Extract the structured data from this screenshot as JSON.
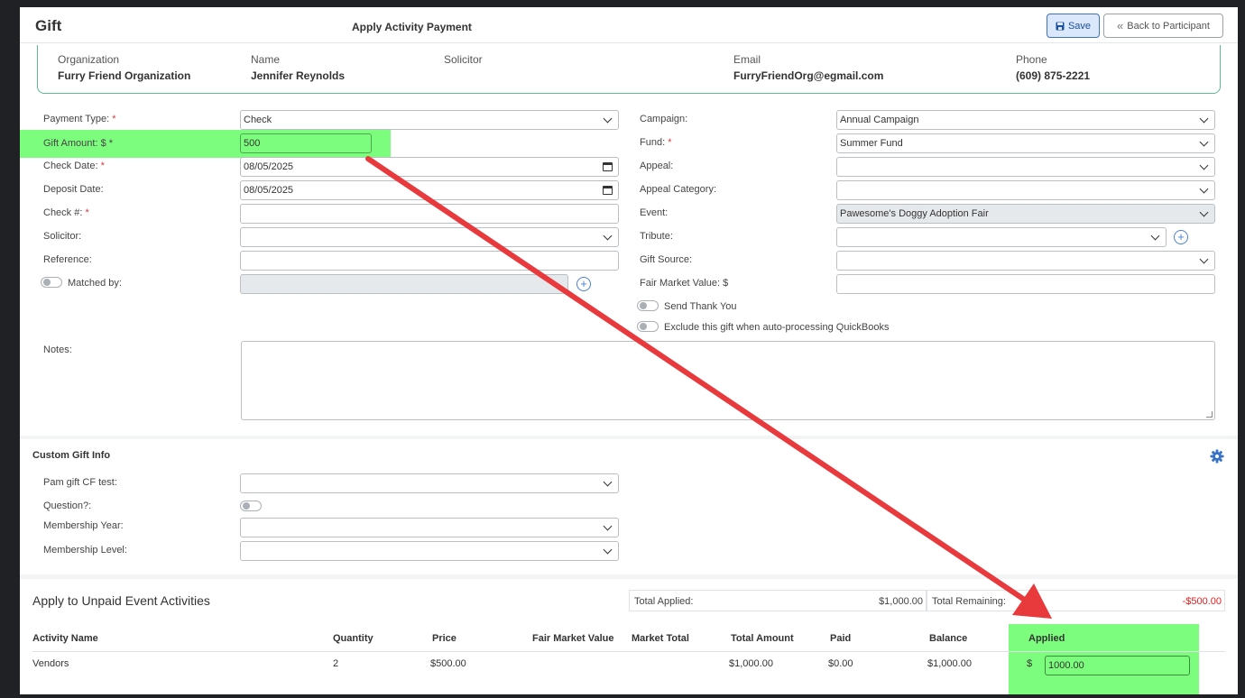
{
  "header": {
    "title": "Gift",
    "subtitle": "Apply Activity Payment",
    "save_label": "Save",
    "back_label": "Back to Participant"
  },
  "participant": {
    "organization_label": "Organization",
    "organization": "Furry Friend Organization",
    "name_label": "Name",
    "name": "Jennifer Reynolds",
    "solicitor_label": "Solicitor",
    "email_label": "Email",
    "email": "FurryFriendOrg@egmail.com",
    "phone_label": "Phone",
    "phone": "(609) 875-2221"
  },
  "form_left": {
    "payment_type_label": "Payment Type:",
    "payment_type": "Check",
    "gift_amount_label": "Gift Amount: $",
    "gift_amount": "500",
    "check_date_label": "Check Date:",
    "check_date": "08/05/2025",
    "deposit_date_label": "Deposit Date:",
    "deposit_date": "08/05/2025",
    "check_no_label": "Check #:",
    "solicitor_label": "Solicitor:",
    "reference_label": "Reference:",
    "matched_by_label": "Matched by:",
    "notes_label": "Notes:",
    "required_mark": "*"
  },
  "form_right": {
    "campaign_label": "Campaign:",
    "campaign": "Annual Campaign",
    "fund_label": "Fund:",
    "fund": "Summer Fund",
    "appeal_label": "Appeal:",
    "appeal_category_label": "Appeal Category:",
    "event_label": "Event:",
    "event": "Pawesome's Doggy Adoption Fair",
    "tribute_label": "Tribute:",
    "gift_source_label": "Gift Source:",
    "fmv_label": "Fair Market Value: $",
    "send_thank_you_label": "Send Thank You",
    "exclude_qb_label": "Exclude this gift when auto-processing QuickBooks"
  },
  "custom_info": {
    "title": "Custom Gift Info",
    "pam_label": "Pam gift CF test:",
    "question_label": "Question?:",
    "membership_year_label": "Membership Year:",
    "membership_level_label": "Membership Level:"
  },
  "apply_section": {
    "title": "Apply to Unpaid Event Activities",
    "total_applied_label": "Total Applied:",
    "total_applied": "$1,000.00",
    "total_remaining_label": "Total Remaining:",
    "total_remaining": "-$500.00",
    "columns": [
      "Activity Name",
      "Quantity",
      "Price",
      "Fair Market Value",
      "Market Total",
      "Total Amount",
      "Paid",
      "Balance",
      "Applied"
    ],
    "row": {
      "activity_name": "Vendors",
      "quantity": "2",
      "price": "$500.00",
      "fair_market_value": "",
      "market_total": "",
      "total_amount": "$1,000.00",
      "paid": "$0.00",
      "balance": "$1,000.00",
      "applied_currency": "$",
      "applied": "1000.00"
    }
  },
  "colors": {
    "highlight": "#7dfd7d",
    "arrow": "#e8393c",
    "negative": "#e02020",
    "accent": "#3a72c6"
  }
}
